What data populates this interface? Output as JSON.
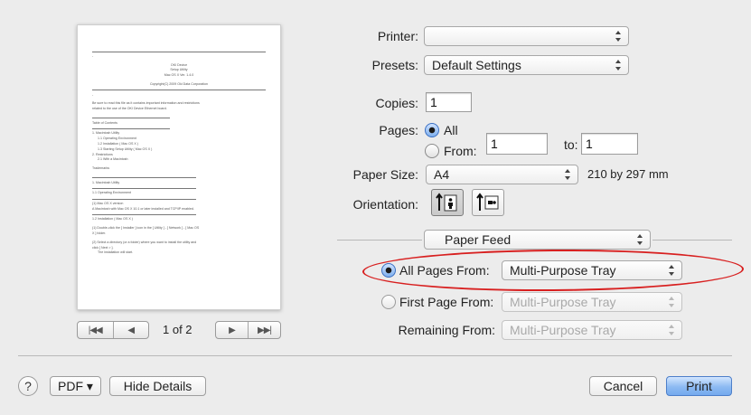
{
  "preview": {
    "lines": [
      "====================================================================",
      "-",
      "OKI Device",
      "Setup Utility",
      "Mac OS X Ver. 1.4.0",
      "Copyright(C) 2009 Oki Data Corporation",
      "====================================================================",
      "-",
      "Be sure to read this file as it contains important information and restrictions",
      "related to the use of the OKI Device Ethernet board.",
      "Table of Contents",
      "1. Macintosh Utility",
      "1.1 Operating Environment",
      "1.2 Installation ( Mac OS X )",
      "1.3 Starting Setup Utility ( Mac OS X )",
      "2. Restrictions",
      "2.1 With a Macintosh",
      "Trademarks",
      "1. Macintosh Utility",
      "1.1 Operating Environment",
      "(1) Mac OS X version",
      "A Macintosh with Mac OS X 10.1 or later installed and TCP/IP enabled.",
      "1.2 Installation ( Mac OS X )",
      "(1) Double-click the [ Installer ] icon in the [ Utility ] - [ Network ] - [ Mac OS",
      "X ] folder.",
      "(2) Select a directory (or a folder) where you want to install the utility and",
      "click [ Next > ].",
      "The installation will start."
    ],
    "page_indicator": "1 of 2"
  },
  "icons": {
    "first_page": "first-page-icon",
    "prev_page": "prev-page-icon",
    "next_page": "next-page-icon",
    "last_page": "last-page-icon"
  },
  "form": {
    "printer_label": "Printer:",
    "printer_value": "",
    "presets_label": "Presets:",
    "presets_value": "Default Settings",
    "copies_label": "Copies:",
    "copies_value": "1",
    "pages_label": "Pages:",
    "pages_all": "All",
    "pages_from": "From:",
    "pages_from_value": "1",
    "pages_to": "to:",
    "pages_to_value": "1",
    "paper_size_label": "Paper Size:",
    "paper_size_value": "A4",
    "paper_size_dims": "210 by 297 mm",
    "orientation_label": "Orientation:",
    "section_popup": "Paper Feed",
    "all_pages_from_label": "All Pages From:",
    "all_pages_from_value": "Multi-Purpose Tray",
    "first_page_from_label": "First Page From:",
    "first_page_from_value": "Multi-Purpose Tray",
    "remaining_from_label": "Remaining From:",
    "remaining_from_value": "Multi-Purpose Tray"
  },
  "footer": {
    "help": "?",
    "pdf": "PDF ▾",
    "hide_details": "Hide Details",
    "cancel": "Cancel",
    "print": "Print"
  },
  "colors": {
    "annotation_ring": "#d82020",
    "default_button": "#74a9ee"
  }
}
